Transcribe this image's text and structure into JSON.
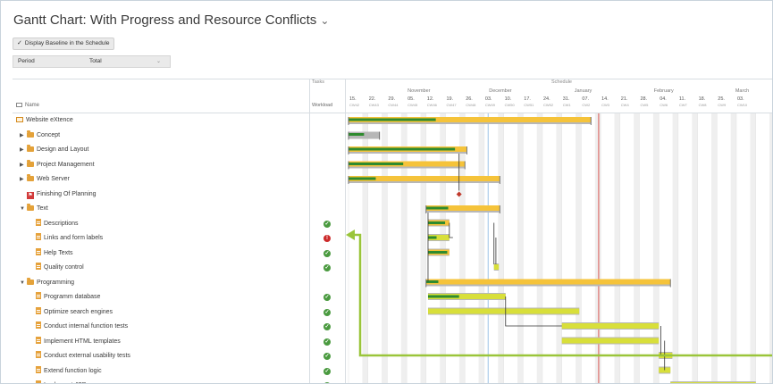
{
  "window": {
    "title": "Gantt Chart: With Progress and Resource Conflicts"
  },
  "toolbar": {
    "baseline_label": "Display Baseline in the Schedule",
    "baseline_checked": true
  },
  "period": {
    "label": "Period",
    "value": "Total"
  },
  "columns": {
    "name_header": "Name",
    "tasks_group": "Tasks",
    "workload_header": "Workload",
    "schedule_group": "Schedule"
  },
  "timeline": {
    "months": [
      "November",
      "December",
      "January",
      "February",
      "March"
    ],
    "days": [
      "15.",
      "22.",
      "29.",
      "05.",
      "12.",
      "19.",
      "26.",
      "03.",
      "10.",
      "17.",
      "24.",
      "31.",
      "07.",
      "14.",
      "21.",
      "28.",
      "04.",
      "11.",
      "18.",
      "25.",
      "03."
    ],
    "calendar_weeks": [
      "CW42",
      "CW43",
      "CW44",
      "CW45",
      "CW46",
      "CW47",
      "CW48",
      "CW49",
      "CW50",
      "CW51",
      "CW52",
      "CW1",
      "CW2",
      "CW3",
      "CW4",
      "CW5",
      "CW6",
      "CW7",
      "CW8",
      "CW9",
      "CW10"
    ]
  },
  "rows": [
    {
      "name": "Website eXtence",
      "level": 0,
      "type": "root",
      "arrow": ""
    },
    {
      "name": "Concept",
      "level": 1,
      "type": "group",
      "arrow": "▶"
    },
    {
      "name": "Design and Layout",
      "level": 1,
      "type": "group",
      "arrow": "▶"
    },
    {
      "name": "Project Management",
      "level": 1,
      "type": "group",
      "arrow": "▶"
    },
    {
      "name": "Web Server",
      "level": 1,
      "type": "group",
      "arrow": "▶"
    },
    {
      "name": "Finishing Of Planning",
      "level": 1,
      "type": "milestone",
      "arrow": ""
    },
    {
      "name": "Text",
      "level": 1,
      "type": "group",
      "arrow": "▼"
    },
    {
      "name": "Descriptions",
      "level": 2,
      "type": "task",
      "arrow": "",
      "status": "ok"
    },
    {
      "name": "Links and form labels",
      "level": 2,
      "type": "task",
      "arrow": "",
      "status": "err"
    },
    {
      "name": "Help Texts",
      "level": 2,
      "type": "task",
      "arrow": "",
      "status": "ok"
    },
    {
      "name": "Quality control",
      "level": 2,
      "type": "task",
      "arrow": "",
      "status": "ok"
    },
    {
      "name": "Programming",
      "level": 1,
      "type": "group",
      "arrow": "▼"
    },
    {
      "name": "Programm database",
      "level": 2,
      "type": "task",
      "arrow": "",
      "status": "ok"
    },
    {
      "name": "Optimize search engines",
      "level": 2,
      "type": "task",
      "arrow": "",
      "status": "ok"
    },
    {
      "name": "Conduct internal function tests",
      "level": 2,
      "type": "task",
      "arrow": "",
      "status": "ok"
    },
    {
      "name": "Implement HTML templates",
      "level": 2,
      "type": "task",
      "arrow": "",
      "status": "ok"
    },
    {
      "name": "Conduct external usability tests",
      "level": 2,
      "type": "task",
      "arrow": "",
      "status": "ok"
    },
    {
      "name": "Extend function logic",
      "level": 2,
      "type": "task",
      "arrow": "",
      "status": "ok"
    },
    {
      "name": "Implement JSP pages",
      "level": 2,
      "type": "task",
      "arrow": "",
      "status": "ok"
    }
  ],
  "colors": {
    "progress": "#2e8b2e",
    "planned_yellow": "#f5c33a",
    "planned_lime": "#d8df3a",
    "baseline_gray": "#b7b7b7",
    "today_line": "#d9534f",
    "status_line": "#9cc3e6",
    "weekend_shade": "#efefef",
    "callout": "#9ac53a",
    "dependency": "#333333"
  },
  "bars": [
    {
      "row": 0,
      "type": "summary",
      "start_week": 0.0,
      "end_week": 12.5,
      "progress": 0.36
    },
    {
      "row": 1,
      "type": "summary",
      "start_week": 0.0,
      "end_week": 1.6,
      "progress": 0.5,
      "color": "gray"
    },
    {
      "row": 2,
      "type": "summary",
      "start_week": 0.0,
      "end_week": 6.1,
      "progress": 0.9
    },
    {
      "row": 3,
      "type": "summary",
      "start_week": 0.0,
      "end_week": 6.0,
      "progress": 0.47
    },
    {
      "row": 4,
      "type": "summary",
      "start_week": 0.0,
      "end_week": 7.8,
      "progress": 0.18
    },
    {
      "row": 6,
      "type": "summary",
      "start_week": 4.0,
      "end_week": 7.8,
      "progress": 0.3
    },
    {
      "row": 7,
      "type": "task",
      "start_week": 4.1,
      "end_week": 5.2,
      "progress": 0.8
    },
    {
      "row": 8,
      "type": "task",
      "start_week": 4.1,
      "end_week": 5.2,
      "progress": 0.4,
      "color": "lime"
    },
    {
      "row": 9,
      "type": "task",
      "start_week": 4.1,
      "end_week": 5.2,
      "progress": 0.9
    },
    {
      "row": 10,
      "type": "task",
      "start_week": 7.5,
      "end_week": 7.75,
      "progress": 0.0,
      "color": "lime"
    },
    {
      "row": 11,
      "type": "summary",
      "start_week": 4.0,
      "end_week": 16.6,
      "progress": 0.05
    },
    {
      "row": 12,
      "type": "task",
      "start_week": 4.1,
      "end_week": 8.1,
      "progress": 0.4,
      "color": "lime"
    },
    {
      "row": 13,
      "type": "task",
      "start_week": 4.1,
      "end_week": 11.9,
      "progress": 0.0,
      "color": "lime"
    },
    {
      "row": 14,
      "type": "task",
      "start_week": 11.0,
      "end_week": 16.0,
      "progress": 0.0,
      "color": "lime"
    },
    {
      "row": 15,
      "type": "task",
      "start_week": 11.0,
      "end_week": 16.0,
      "progress": 0.0,
      "color": "lime"
    },
    {
      "row": 16,
      "type": "task",
      "start_week": 16.0,
      "end_week": 16.7,
      "progress": 0.0,
      "color": "lime"
    },
    {
      "row": 17,
      "type": "task",
      "start_week": 16.0,
      "end_week": 16.6,
      "progress": 0.0,
      "color": "lime"
    },
    {
      "row": 18,
      "type": "task",
      "start_week": 16.6,
      "end_week": 21.0,
      "progress": 0.0,
      "color": "lime"
    }
  ],
  "markers": {
    "status_date_week": 7.2,
    "today_week": 12.9
  }
}
